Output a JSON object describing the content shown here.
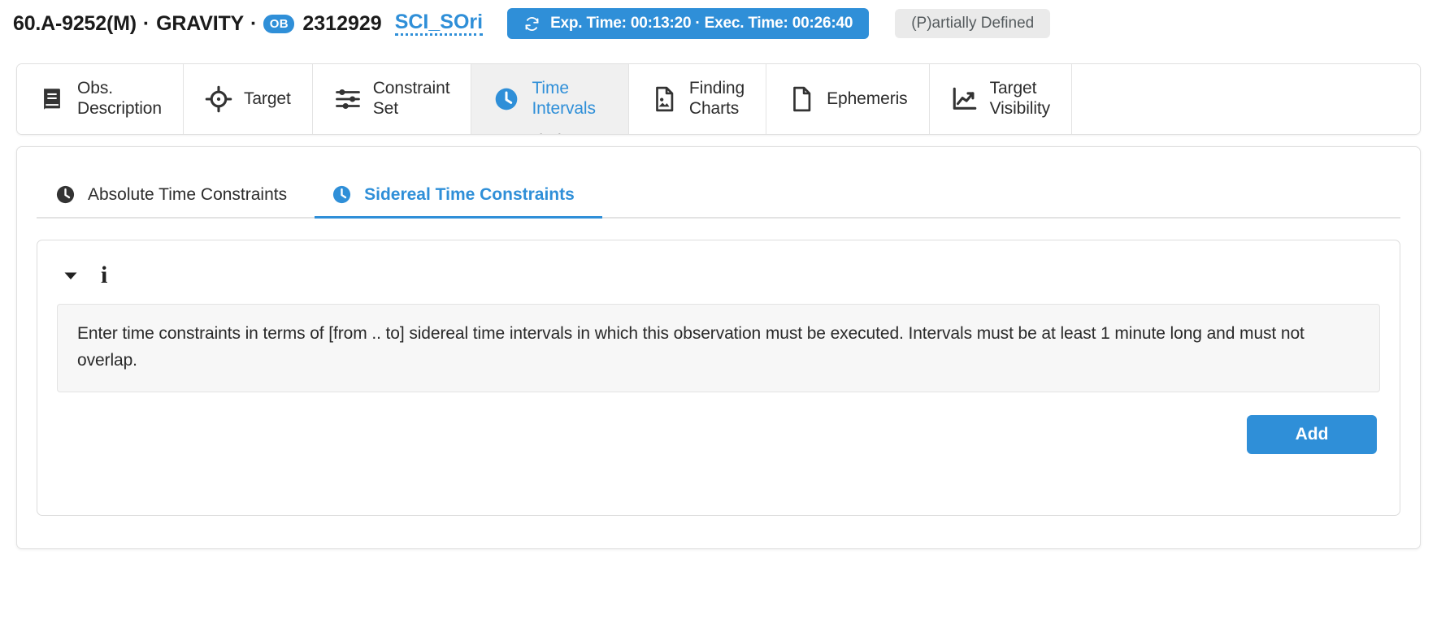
{
  "header": {
    "program_id": "60.A-9252(M)",
    "instrument": "GRAVITY",
    "separator": "·",
    "ob_badge": "OB",
    "ob_number": "2312929",
    "target_link": "SCI_SOri",
    "time_badge": "Exp. Time: 00:13:20 · Exec. Time: 00:26:40",
    "status_badge": "(P)artially Defined",
    "sync_icon": "sync-icon",
    "accent_color": "#2f8fd8",
    "status_bg": "#eaeaea"
  },
  "tabs": [
    {
      "label": "Obs.\nDescription",
      "icon": "book-icon",
      "active": false
    },
    {
      "label": "Target",
      "icon": "crosshairs-icon",
      "active": false
    },
    {
      "label": "Constraint\nSet",
      "icon": "sliders-icon",
      "active": false
    },
    {
      "label": "Time\nIntervals",
      "icon": "clock-icon",
      "active": true
    },
    {
      "label": "Finding\nCharts",
      "icon": "file-image-icon",
      "active": false
    },
    {
      "label": "Ephemeris",
      "icon": "file-icon",
      "active": false
    },
    {
      "label": "Target\nVisibility",
      "icon": "chart-line-up-icon",
      "active": false
    }
  ],
  "subtabs": [
    {
      "label": "Absolute Time Constraints",
      "icon": "clock-icon",
      "active": false
    },
    {
      "label": "Sidereal Time Constraints",
      "icon": "clock-icon",
      "active": true
    }
  ],
  "panel": {
    "collapse_icon": "caret-down-icon",
    "info_icon": "info-icon",
    "info_text": "Enter time constraints in terms of [from .. to] sidereal time intervals in which this observation must be executed. Intervals must be at least 1 minute long and must not overlap.",
    "add_label": "Add"
  }
}
